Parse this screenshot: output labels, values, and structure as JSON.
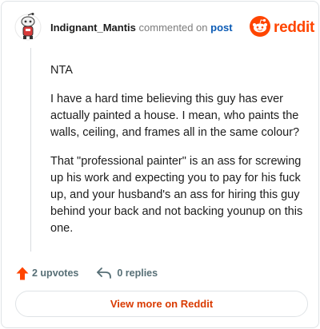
{
  "header": {
    "username": "Indignant_Mantis",
    "action_text": "commented on",
    "post_link": "post",
    "logo_text": "reddit"
  },
  "comment": {
    "paragraphs": [
      "NTA",
      "I have a hard time believing this guy has ever actually painted a house. I mean, who paints the walls, ceiling, and frames all in the same colour?",
      "That \"professional painter\" is an ass for screwing up his work and expecting you to pay for his fuck up, and your husband's an ass for hiring this guy behind your back and not backing younup on this one."
    ]
  },
  "actions": {
    "upvotes": "2 upvotes",
    "replies": "0 replies"
  },
  "footer": {
    "view_more": "View more on Reddit"
  },
  "colors": {
    "brand": "#ff4500",
    "link": "#0b5bb5",
    "view_more_text": "#d93a00"
  },
  "icons": {
    "avatar": "snoo-avatar-icon",
    "logo": "reddit-snoo-icon",
    "upvote": "upvote-arrow-icon",
    "reply": "reply-arrow-icon"
  }
}
